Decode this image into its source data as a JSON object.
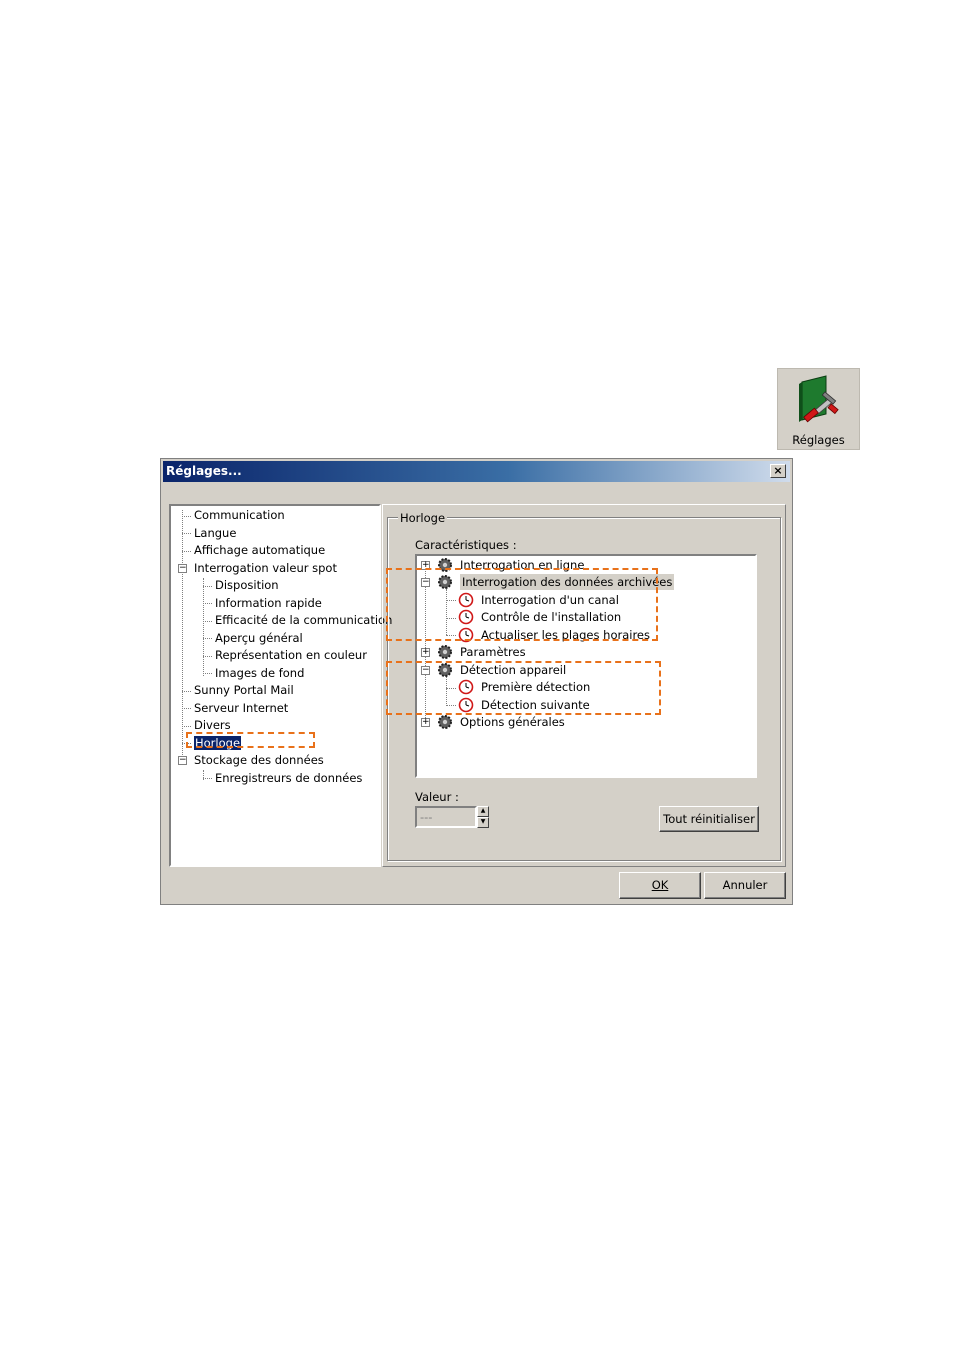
{
  "app_icon": {
    "label": "Réglages"
  },
  "dialog": {
    "title": "Réglages...",
    "close_label": "×",
    "nav": [
      {
        "label": "Communication"
      },
      {
        "label": "Langue"
      },
      {
        "label": "Affichage automatique"
      },
      {
        "label": "Interrogation valeur spot",
        "expanded": true
      },
      {
        "label": "Disposition"
      },
      {
        "label": "Information rapide"
      },
      {
        "label": "Efficacité de la communication"
      },
      {
        "label": "Aperçu général"
      },
      {
        "label": "Représentation en couleur"
      },
      {
        "label": "Images de fond"
      },
      {
        "label": "Sunny Portal Mail"
      },
      {
        "label": "Serveur Internet"
      },
      {
        "label": "Divers"
      },
      {
        "label": "Horloge",
        "selected": true
      },
      {
        "label": "Stockage des données",
        "expanded": true
      },
      {
        "label": "Enregistreurs de données"
      }
    ],
    "group_title": "Horloge",
    "features_label": "Caractéristiques :",
    "features": [
      {
        "label": "Interrogation en ligne"
      },
      {
        "label": "Interrogation des données archivées"
      },
      {
        "label": "Interrogation d'un canal"
      },
      {
        "label": "Contrôle de l'installation"
      },
      {
        "label": "Actualiser les plages horaires"
      },
      {
        "label": "Paramètres"
      },
      {
        "label": "Détection appareil"
      },
      {
        "label": "Première détection"
      },
      {
        "label": "Détection suivante"
      },
      {
        "label": "Options générales"
      }
    ],
    "expander_plus": "+",
    "expander_minus": "−",
    "value_label": "Valeur :",
    "value_field": "---",
    "reset_button": "Tout réinitialiser",
    "ok_button": "OK",
    "cancel_button": "Annuler",
    "highlight_color": "#e8711a"
  }
}
